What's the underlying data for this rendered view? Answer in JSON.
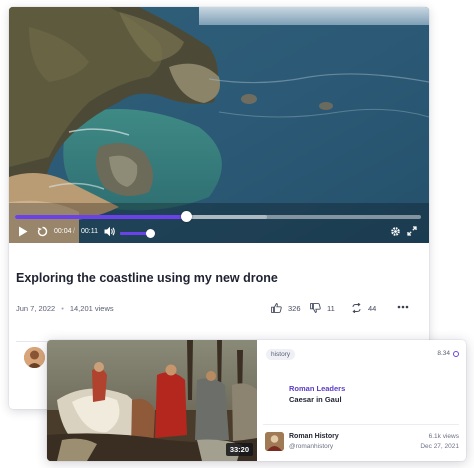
{
  "player": {
    "current_time": "00:04",
    "time_separator": "/",
    "duration": "00:11",
    "progress_fraction": 0.42,
    "buffered_fraction": 0.62,
    "volume_fraction": 0.9,
    "accent_color": "#6a42e8"
  },
  "video": {
    "title": "Exploring the coastline using my new drone",
    "date": "Jun 7, 2022",
    "views": "14,201 views",
    "likes": "326",
    "dislikes": "11",
    "shares": "44"
  },
  "popup": {
    "tag": "history",
    "count": "8.34",
    "duration": "33:20",
    "title_line1": "Roman Leaders",
    "title_line2": "Caesar in Gaul",
    "channel_name": "Roman History",
    "channel_handle": "@romanhistory",
    "views": "6.1k views",
    "date": "Dec 27, 2021"
  },
  "icons": [
    "play-icon",
    "replay-icon",
    "volume-icon",
    "settings-icon",
    "fullscreen-icon",
    "thumbs-up-icon",
    "thumbs-down-icon",
    "share-icon",
    "more-icon"
  ]
}
